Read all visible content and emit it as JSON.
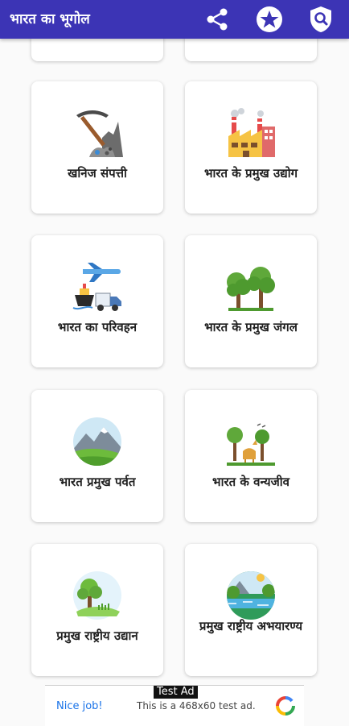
{
  "app": {
    "title": "भारत का भूगोल",
    "accent": "#3c34b5"
  },
  "actions": [
    {
      "name": "share",
      "icon": "share-icon"
    },
    {
      "name": "rate",
      "icon": "star-icon"
    },
    {
      "name": "privacy",
      "icon": "shield-search-icon"
    }
  ],
  "cards": [
    {
      "label": "खनिज संपत्ती",
      "icon": "pickaxe-minerals-icon"
    },
    {
      "label": "भारत के प्रमुख उद्योग",
      "icon": "factory-icon"
    },
    {
      "label": "भारत का परिवहन",
      "icon": "transport-icon"
    },
    {
      "label": "भारत के प्रमुख जंगल",
      "icon": "forest-icon"
    },
    {
      "label": "भारत प्रमुख पर्वत",
      "icon": "mountain-icon"
    },
    {
      "label": "भारत के वन्यजीव",
      "icon": "wildlife-icon"
    },
    {
      "label": "प्रमुख राष्ट्रीय उद्यान",
      "icon": "park-icon"
    },
    {
      "label": "प्रमुख राष्ट्रीय अभयारण्य",
      "icon": "sanctuary-icon"
    }
  ],
  "ad": {
    "tag": "Test Ad",
    "headline": "Nice job!",
    "text": "This is a 468x60 test ad."
  }
}
